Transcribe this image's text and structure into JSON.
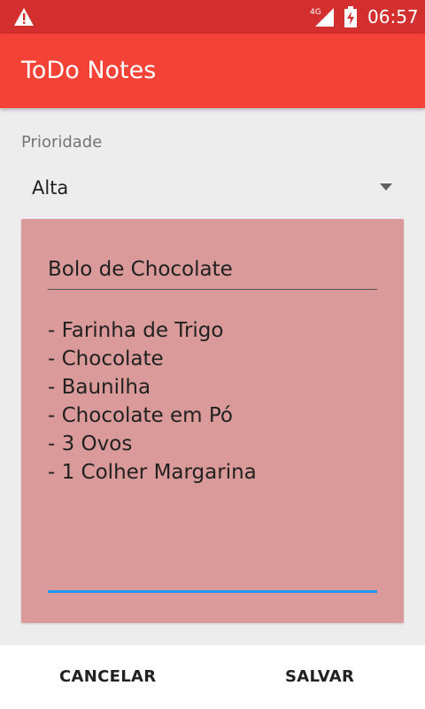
{
  "status_bar": {
    "time": "06:57",
    "network": "4G",
    "background_color": "#d32f2f"
  },
  "app_bar": {
    "title": "ToDo Notes",
    "background_color": "#f44336"
  },
  "form": {
    "priority_label": "Prioridade",
    "priority_selected": "Alta"
  },
  "note": {
    "title": "Bolo de Chocolate",
    "lines": [
      "- Farinha de Trigo",
      "- Chocolate",
      "- Baunilha",
      "- Chocolate em Pó",
      "- 3 Ovos",
      "- 1 Colher Margarina"
    ],
    "card_color": "#d99a99"
  },
  "actions": {
    "cancel_label": "CANCELAR",
    "save_label": "SALVAR"
  }
}
